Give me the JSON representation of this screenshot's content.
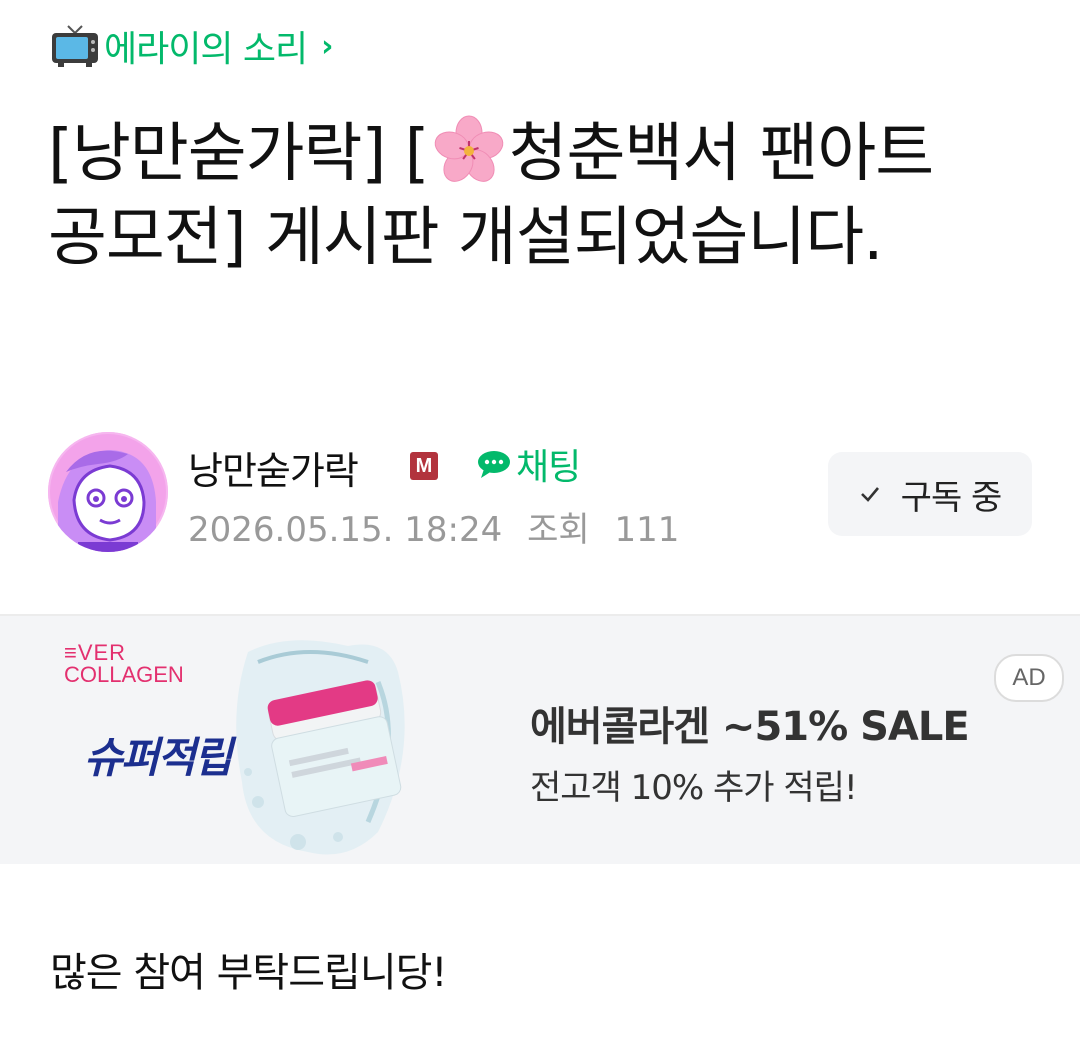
{
  "breadcrumb": {
    "board_name": "에라이의 소리",
    "chevron": "›",
    "icon": "tv-icon"
  },
  "post": {
    "title_prefix": "[낭만숟가락] [",
    "title_suffix": "청춘백서 팬아트 공모전] 게시판 개설되었습니다.",
    "title_emoji_icon": "cherry-blossom-icon",
    "body": "많은 참여 부탁드립니당!"
  },
  "author": {
    "name": "낭만숟가락",
    "badge": "M",
    "chat_label": "채팅",
    "date": "2026.05.15. 18:24",
    "views_label": "조회",
    "views": "111"
  },
  "subscribe": {
    "label": "구독 중",
    "icon": "check-icon"
  },
  "ad": {
    "brand_line1": "≡VER",
    "brand_line2": "COLLAGEN",
    "slogan": "슈퍼적립",
    "headline": "에버콜라겐 ~51% SALE",
    "subtext": "전고객 10% 추가 적립!",
    "badge": "AD"
  },
  "colors": {
    "accent_green": "#03b96b",
    "badge_red": "#b2333d",
    "ad_pink": "#e3306f",
    "ad_navy": "#1c2f8f"
  }
}
